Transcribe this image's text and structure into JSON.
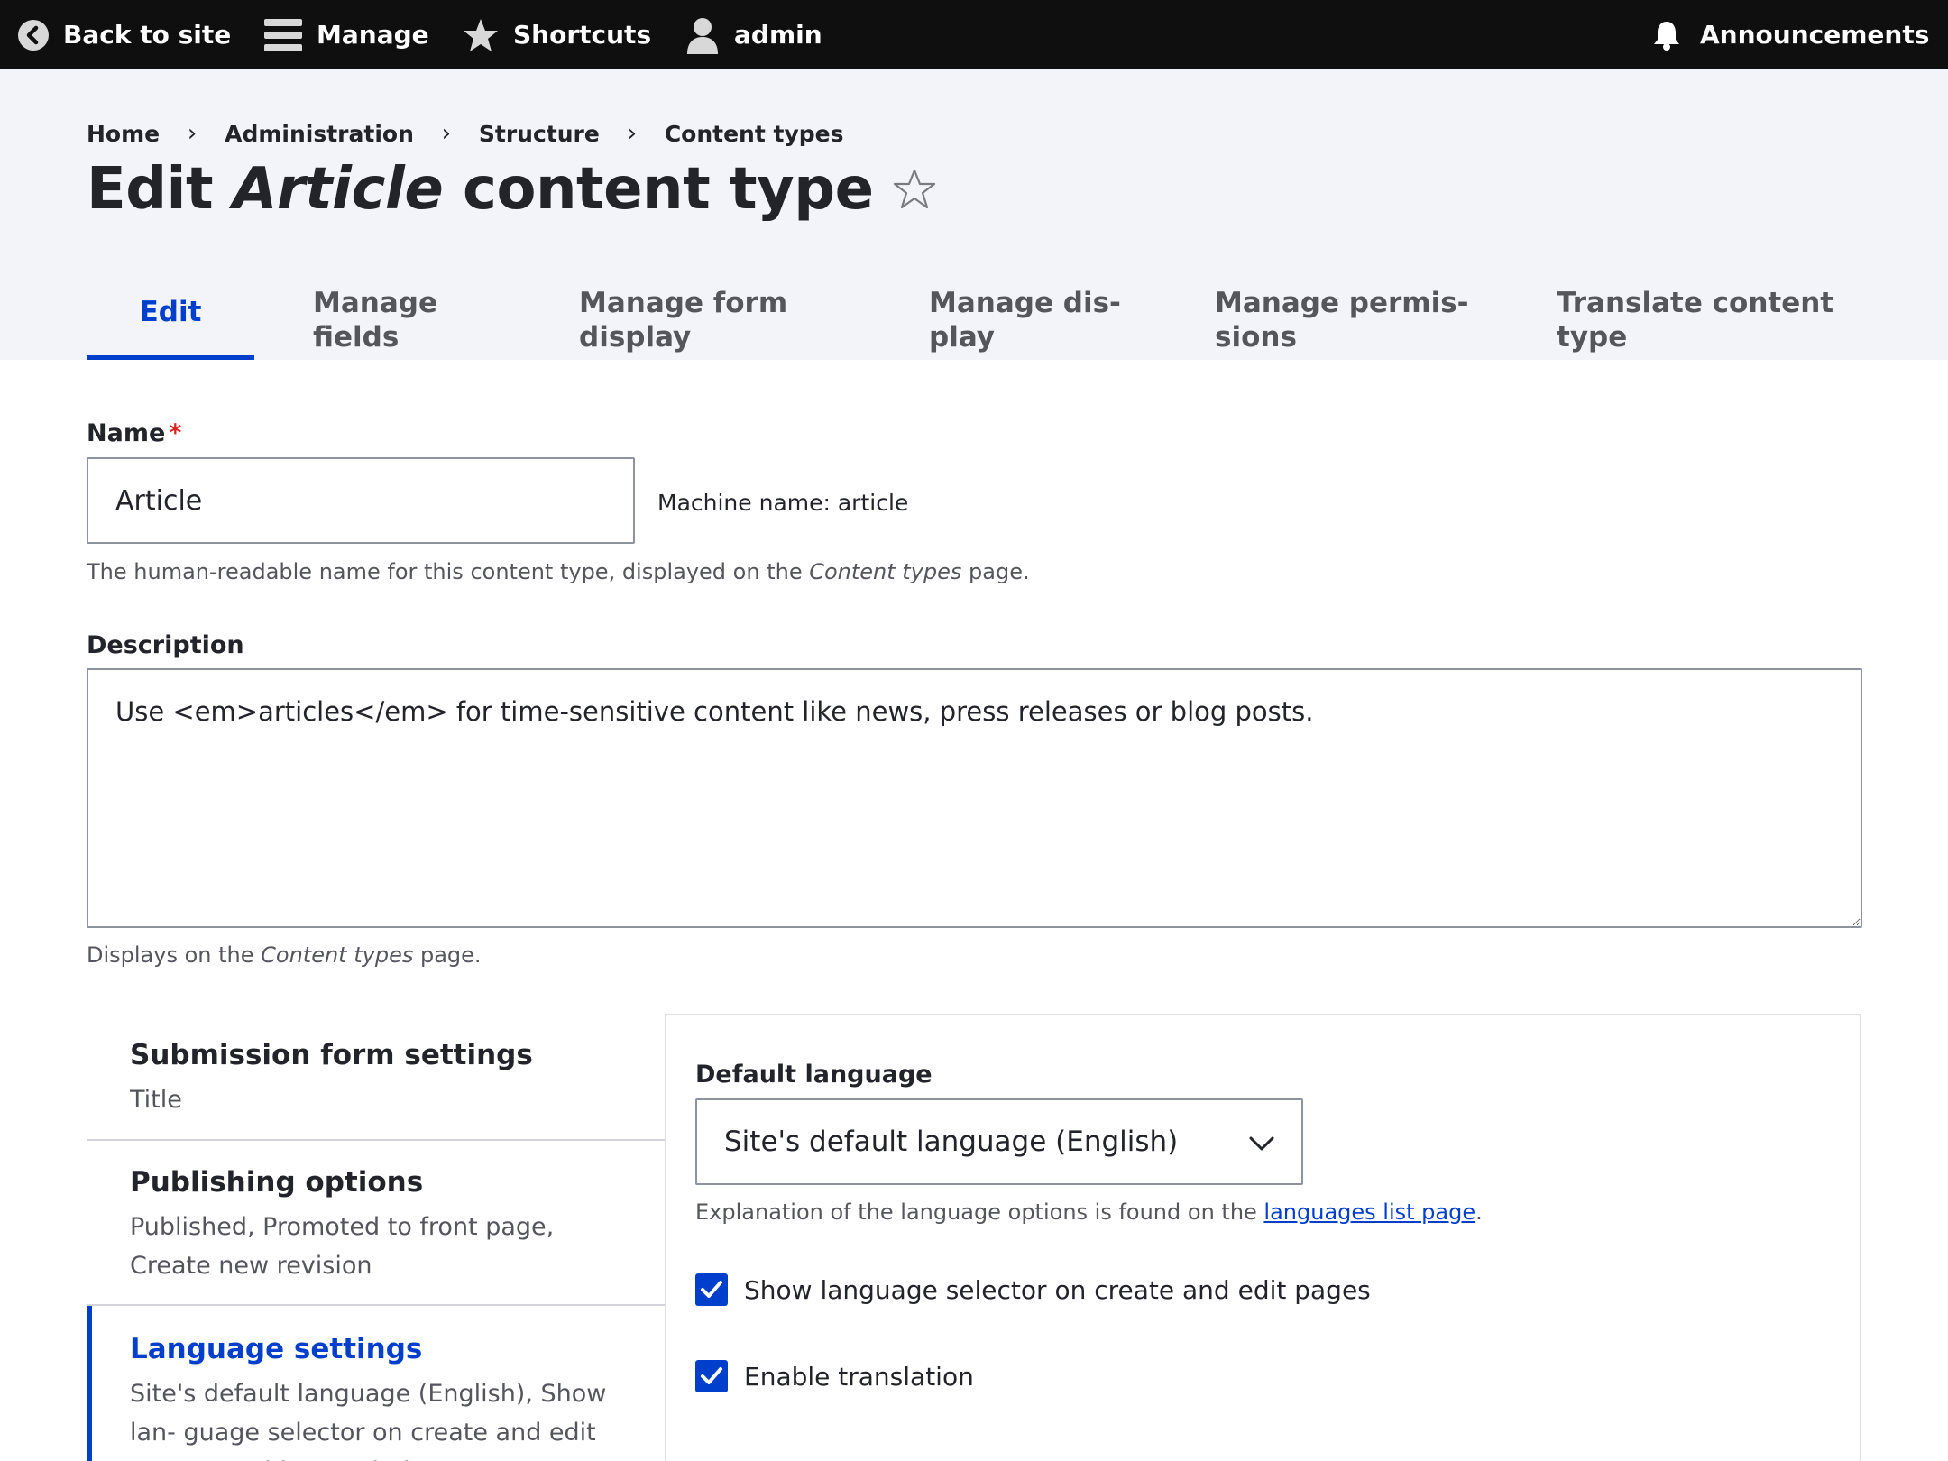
{
  "toolbar": {
    "back_label": "Back to site",
    "manage_label": "Manage",
    "shortcuts_label": "Shortcuts",
    "user_label": "admin",
    "announcements_label": "Announcements"
  },
  "breadcrumb": [
    "Home",
    "Administration",
    "Structure",
    "Content types"
  ],
  "title": {
    "prefix": "Edit ",
    "emphasis": "Article",
    "suffix": " content type"
  },
  "tabs": [
    {
      "label": "Edit",
      "active": true
    },
    {
      "label_line1": "Manage",
      "label_line2": "fields"
    },
    {
      "label_line1": "Manage form",
      "label_line2": "display"
    },
    {
      "label_line1": "Manage dis-",
      "label_line2": "play"
    },
    {
      "label_line1": "Manage permis-",
      "label_line2": "sions"
    },
    {
      "label_line1": "Translate content",
      "label_line2": "type"
    }
  ],
  "form": {
    "name_label": "Name",
    "required_marker": "*",
    "name_value": "Article",
    "machine_name": "Machine name: article",
    "name_hint_pre": "The human-readable name for this content type, displayed on the ",
    "name_hint_em": "Content types",
    "name_hint_post": " page.",
    "description_label": "Description",
    "description_value": "Use <em>articles</em> for time-sensitive content like news, press releases or blog posts.",
    "description_hint_pre": "Displays on the ",
    "description_hint_em": "Content types",
    "description_hint_post": " page."
  },
  "vertical_tabs": [
    {
      "title": "Submission form settings",
      "summary": "Title"
    },
    {
      "title": "Publishing options",
      "summary": "Published, Promoted to front page, Create new revision"
    },
    {
      "title": "Language settings",
      "summary": "Site's default language (English), Show lan- guage selector on create and edit pages, Enable translation",
      "active": true
    }
  ],
  "language_pane": {
    "default_language_label": "Default language",
    "default_language_value": "Site's default language (English)",
    "explanation_pre": "Explanation of the language options is found on the ",
    "explanation_link": "languages list page",
    "explanation_post": ".",
    "checkbox_selector_label": "Show language selector on create and edit pages",
    "checkbox_selector_checked": true,
    "checkbox_translation_label": "Enable translation",
    "checkbox_translation_checked": true
  },
  "colors": {
    "toolbar_bg": "#0f0f0f",
    "header_bg": "#f3f4f9",
    "accent": "#003ecc",
    "required": "#dc2323"
  }
}
